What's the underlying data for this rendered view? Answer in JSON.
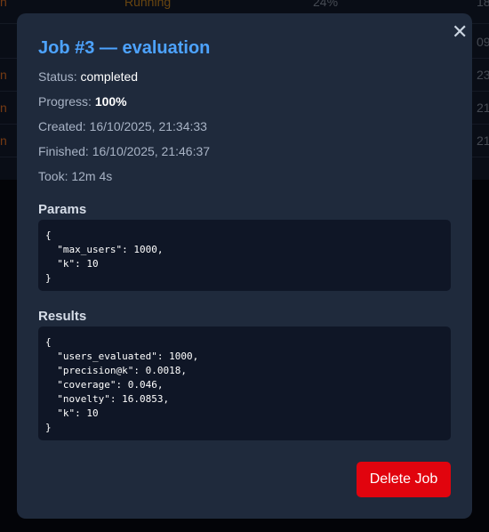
{
  "background_table": {
    "rows": [
      {
        "left": "n",
        "status": "Running",
        "progress": "24%",
        "right": "18"
      },
      {
        "left": "",
        "status": "",
        "progress": "",
        "right": "09"
      },
      {
        "left": "n",
        "status": "",
        "progress": "",
        "right": "23"
      },
      {
        "left": "n",
        "status": "",
        "progress": "",
        "right": "21"
      },
      {
        "left": "n",
        "status": "",
        "progress": "",
        "right": "21"
      }
    ]
  },
  "modal": {
    "close_glyph": "✕",
    "title": "Job #3 — evaluation",
    "status_label": "Status:",
    "status_value": "completed",
    "progress_label": "Progress:",
    "progress_value": "100%",
    "created_label": "Created:",
    "created_value": "16/10/2025, 21:34:33",
    "finished_label": "Finished:",
    "finished_value": "16/10/2025, 21:46:37",
    "took_label": "Took:",
    "took_value": "12m 4s",
    "params_title": "Params",
    "params_json": "{\n  \"max_users\": 1000,\n  \"k\": 10\n}",
    "results_title": "Results",
    "results_json": "{\n  \"users_evaluated\": 1000,\n  \"precision@k\": 0.0018,\n  \"coverage\": 0.046,\n  \"novelty\": 16.0853,\n  \"k\": 10\n}",
    "delete_label": "Delete Job"
  },
  "colors": {
    "title": "#4da3ff",
    "modal_bg": "#1f2a3c",
    "code_bg": "#0f1626",
    "danger": "#e1040e"
  }
}
